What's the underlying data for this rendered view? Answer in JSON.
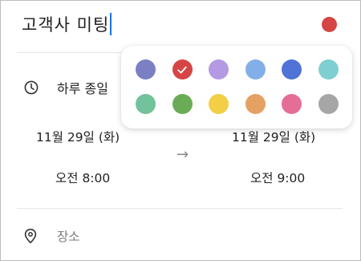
{
  "event": {
    "title": "고객사 미팅",
    "title_color": "#d64545"
  },
  "all_day": {
    "label": "하루 종일"
  },
  "start": {
    "date": "11월 29일 (화)",
    "time": "오전 8:00"
  },
  "end": {
    "date": "11월 29일 (화)",
    "time": "오전 9:00"
  },
  "arrow": "→",
  "location": {
    "placeholder": "장소"
  },
  "color_picker": {
    "selected_index": 1,
    "colors": [
      {
        "name": "lavender-blue",
        "hex": "#7b7fc4"
      },
      {
        "name": "red",
        "hex": "#d64545"
      },
      {
        "name": "light-purple",
        "hex": "#b39ae3"
      },
      {
        "name": "light-blue",
        "hex": "#84aee8"
      },
      {
        "name": "blue",
        "hex": "#4f73d6"
      },
      {
        "name": "teal",
        "hex": "#7dcfd1"
      },
      {
        "name": "mint-green",
        "hex": "#72c29b"
      },
      {
        "name": "green",
        "hex": "#6aab57"
      },
      {
        "name": "yellow",
        "hex": "#f2cf45"
      },
      {
        "name": "orange",
        "hex": "#e3a264"
      },
      {
        "name": "pink",
        "hex": "#e46e96"
      },
      {
        "name": "gray",
        "hex": "#a6a6a6"
      }
    ]
  }
}
